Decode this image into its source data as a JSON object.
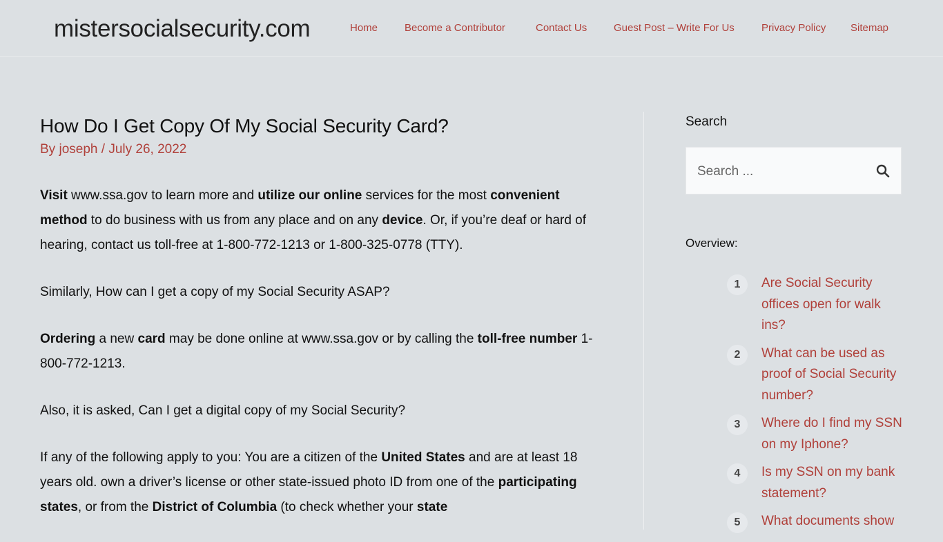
{
  "header": {
    "site_title": "mistersocialsecurity.com",
    "nav": [
      {
        "label": "Home"
      },
      {
        "label": "Become a Contributor"
      },
      {
        "label": "Contact Us"
      },
      {
        "label": "Guest Post – Write For Us"
      },
      {
        "label": "Privacy Policy"
      },
      {
        "label": "Sitemap"
      }
    ]
  },
  "post": {
    "title": "How Do I Get Copy Of My Social Security Card?",
    "by": "By",
    "author": "joseph",
    "separator": "/",
    "date": "July 26, 2022",
    "paragraphs": [
      [
        {
          "b": true,
          "t": "Visit"
        },
        {
          "t": " www.ssa.gov to learn more and "
        },
        {
          "b": true,
          "t": "utilize our online"
        },
        {
          "t": " services for the most "
        },
        {
          "b": true,
          "t": "convenient method"
        },
        {
          "t": " to do business with us from any place and on any "
        },
        {
          "b": true,
          "t": "device"
        },
        {
          "t": ". Or, if you’re deaf or hard of hearing, contact us toll-free at 1-800-772-1213 or 1-800-325-0778 (TTY)."
        }
      ],
      [
        {
          "t": "Similarly, How can I get a copy of my Social Security ASAP?"
        }
      ],
      [
        {
          "b": true,
          "t": "Ordering"
        },
        {
          "t": " a new "
        },
        {
          "b": true,
          "t": "card"
        },
        {
          "t": " may be done online at www.ssa.gov or by calling the "
        },
        {
          "b": true,
          "t": "toll-free number"
        },
        {
          "t": " 1-800-772-1213."
        }
      ],
      [
        {
          "t": "Also, it is asked, Can I get a digital copy of my Social Security?"
        }
      ],
      [
        {
          "t": "If any of the following apply to you: You are a citizen of the "
        },
        {
          "b": true,
          "t": "United States"
        },
        {
          "t": " and are at least 18 years old. own a driver’s license or other state-issued photo ID from one of the "
        },
        {
          "b": true,
          "t": "participating states"
        },
        {
          "t": ", or from the "
        },
        {
          "b": true,
          "t": "District of Columbia"
        },
        {
          "t": " (to check whether your "
        },
        {
          "b": true,
          "t": "state"
        }
      ]
    ]
  },
  "sidebar": {
    "search_title": "Search",
    "search_placeholder": "Search ...",
    "search_icon": "search-icon",
    "overview_label": "Overview:",
    "toc": [
      {
        "num": "1",
        "text": "Are Social Security offices open for walk ins?"
      },
      {
        "num": "2",
        "text": "What can be used as proof of Social Security number?"
      },
      {
        "num": "3",
        "text": "Where do I find my SSN on my Iphone?"
      },
      {
        "num": "4",
        "text": "Is my SSN on my bank statement?"
      },
      {
        "num": "5",
        "text": "What documents show"
      }
    ]
  },
  "colors": {
    "background": "#dce0e3",
    "link": "#b0403a",
    "text": "#111111"
  }
}
